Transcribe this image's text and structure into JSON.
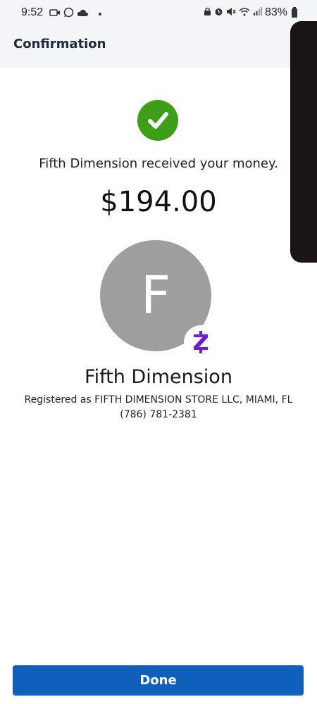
{
  "status_bar": {
    "time": "9:52",
    "battery": "83%",
    "left_icons": [
      "video-icon",
      "whatsapp-icon",
      "cloud-icon",
      "dot-icon"
    ],
    "right_icons": [
      "lock-icon",
      "alarm-icon",
      "mute-icon",
      "wifi-icon",
      "signal-icon",
      "battery-icon"
    ]
  },
  "app_bar": {
    "title": "Confirmation"
  },
  "confirmation": {
    "message": "Fifth Dimension received your money.",
    "amount": "$194.00",
    "success_color": "#3d9f17"
  },
  "recipient": {
    "avatar_letter": "F",
    "name": "Fifth Dimension",
    "registered_as": "Registered as FIFTH DIMENSION STORE LLC, MIAMI, FL",
    "phone": "(786) 781-2381",
    "badge_icon": "zelle-icon",
    "badge_color": "#6d1ed4"
  },
  "actions": {
    "done_label": "Done",
    "done_color": "#0f5fbd"
  }
}
